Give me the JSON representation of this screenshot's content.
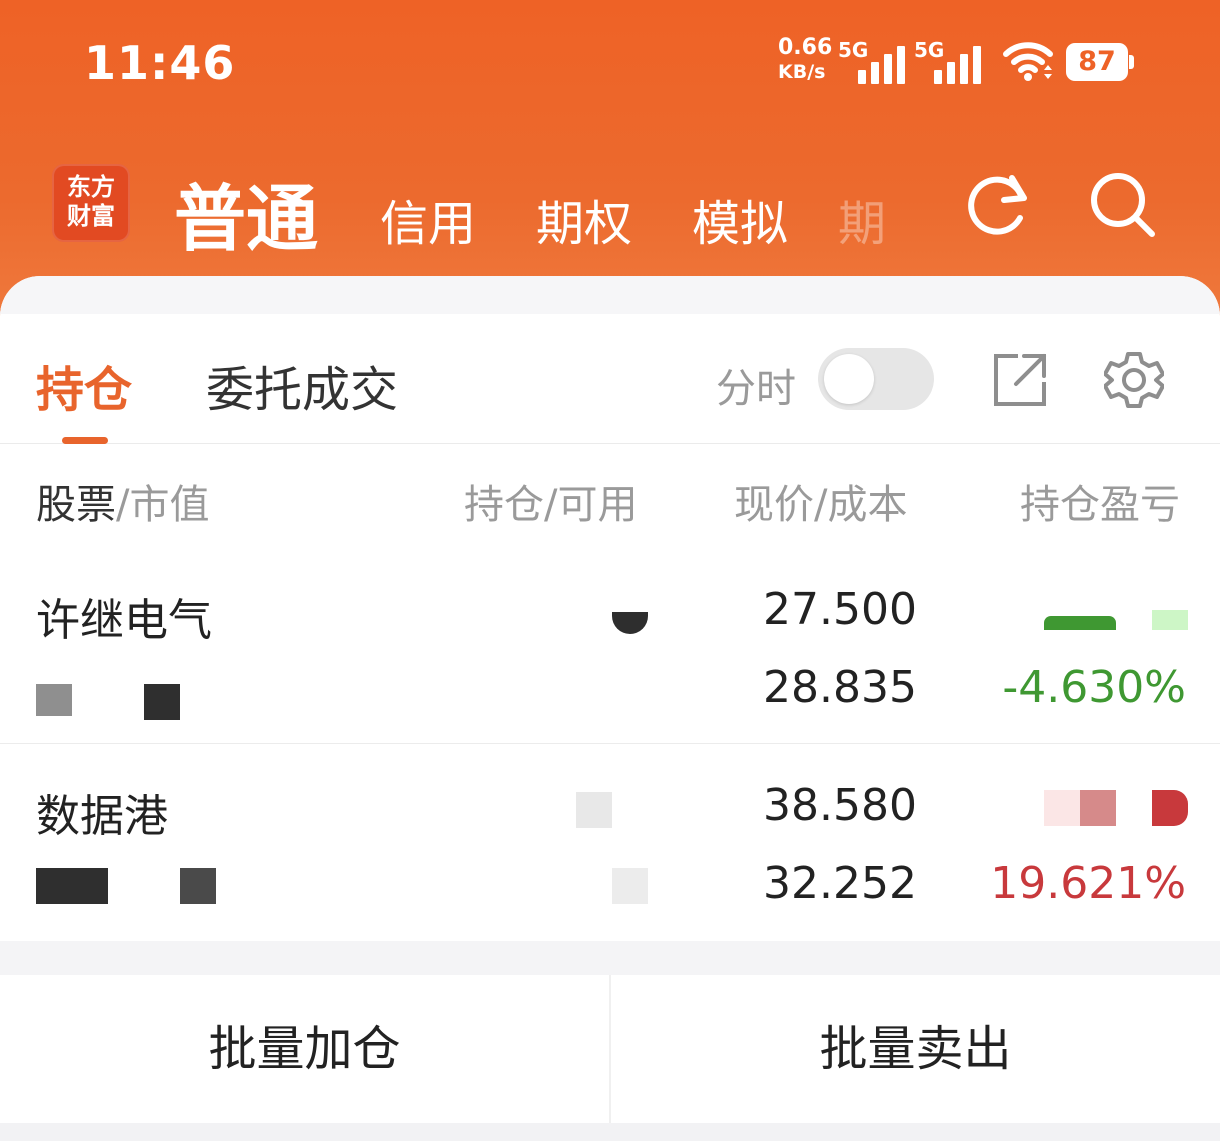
{
  "status_bar": {
    "time": "11:46",
    "speed_value": "0.66",
    "speed_unit": "KB/s",
    "sim1_label": "5G",
    "sim2_label": "5G",
    "battery": "87"
  },
  "app_header": {
    "logo_line1": "东方",
    "logo_line2": "财富",
    "tabs": [
      {
        "label": "普通",
        "active": true
      },
      {
        "label": "信用"
      },
      {
        "label": "期权"
      },
      {
        "label": "模拟"
      }
    ],
    "icons": [
      "refresh-icon",
      "search-icon"
    ]
  },
  "position_tabs": {
    "holdings": "持仓",
    "orders": "委托成交",
    "intraday_label": "分时",
    "intraday_enabled": false
  },
  "columns": {
    "stock_main": "股票",
    "stock_sub": "/市值",
    "holding": "持仓/可用",
    "price": "现价/成本",
    "pnl": "持仓盈亏"
  },
  "holdings": [
    {
      "name": "许继电气",
      "current_price": "27.500",
      "cost_price": "28.835",
      "pnl_percent": "-4.630%"
    },
    {
      "name": "数据港",
      "current_price": "38.580",
      "cost_price": "32.252",
      "pnl_percent": "19.621%"
    }
  ],
  "actions": {
    "batch_add": "批量加仓",
    "batch_sell": "批量卖出"
  },
  "colors": {
    "brand_orange": "#ee6226",
    "loss_green": "#3f9832",
    "gain_red": "#c8393c"
  }
}
